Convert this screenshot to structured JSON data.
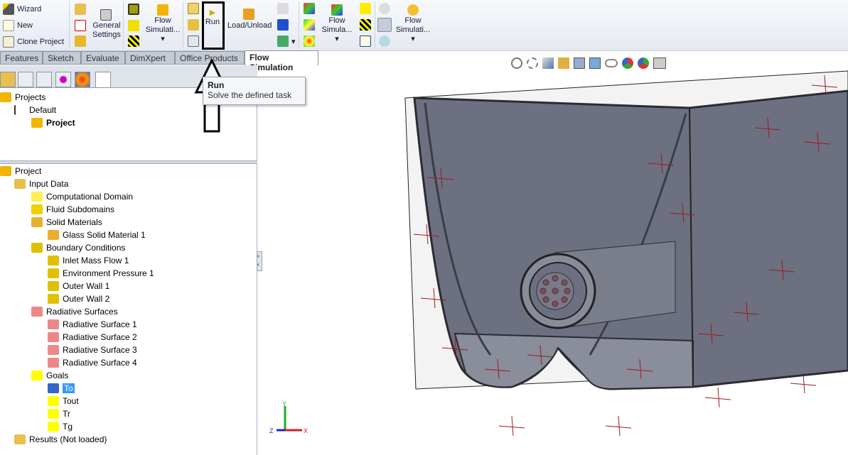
{
  "toolbar": {
    "wizard": "Wizard",
    "new": "New",
    "clone_project": "Clone Project",
    "general_settings_1": "General",
    "general_settings_2": "Settings",
    "flow_sim_1_a": "Flow",
    "flow_sim_1_b": "Simulati...",
    "run": "Run",
    "load_unload": "Load/Unload",
    "flow_sim_2_a": "Flow",
    "flow_sim_2_b": "Simula...",
    "flow_sim_3_a": "Flow",
    "flow_sim_3_b": "Simulati..."
  },
  "tabs": [
    "Features",
    "Sketch",
    "Evaluate",
    "DimXpert",
    "Office Products",
    "Flow Simulation"
  ],
  "active_tab": "Flow Simulation",
  "tooltip": {
    "title": "Run",
    "text": "Solve the defined task"
  },
  "projects_tree": {
    "root": "Projects",
    "config": "Default",
    "project": "Project"
  },
  "analysis_tree": {
    "root": "Project",
    "input_data": "Input Data",
    "computational_domain": "Computational Domain",
    "fluid_subdomains": "Fluid Subdomains",
    "solid_materials": "Solid Materials",
    "glass": "Glass Solid Material 1",
    "boundary_conditions": "Boundary Conditions",
    "bc": [
      "Inlet Mass Flow 1",
      "Environment Pressure 1",
      "Outer Wall 1",
      "Outer Wall 2"
    ],
    "radiative_surfaces": "Radiative Surfaces",
    "rs": [
      "Radiative Surface 1",
      "Radiative Surface 2",
      "Radiative Surface 3",
      "Radiative Surface 4"
    ],
    "goals": "Goals",
    "goal_items": [
      "To",
      "Tout",
      "Tr",
      "Tg"
    ],
    "selected_goal": "To",
    "results": "Results (Not loaded)"
  },
  "triad": {
    "x": "X",
    "y": "Y",
    "z": "Z"
  },
  "colors": {
    "model": "#6b6e7e",
    "model_dark": "#3a3c46",
    "selection": "#3399ff",
    "tab_bg": "#c5cbd5"
  }
}
